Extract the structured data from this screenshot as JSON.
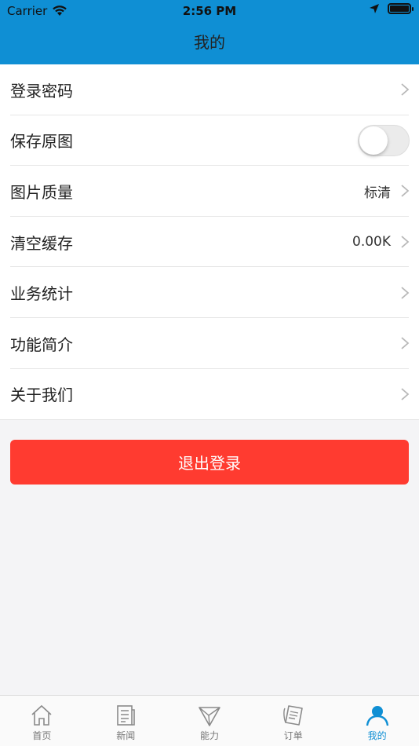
{
  "status_bar": {
    "carrier": "Carrier",
    "time": "2:56 PM"
  },
  "nav": {
    "title": "我的"
  },
  "settings": [
    {
      "label": "登录密码",
      "value": "",
      "kind": "chevron"
    },
    {
      "label": "保存原图",
      "value": "",
      "kind": "toggle",
      "enabled": false
    },
    {
      "label": "图片质量",
      "value": "标清",
      "kind": "chevron"
    },
    {
      "label": "清空缓存",
      "value": "0.00K",
      "kind": "chevron"
    },
    {
      "label": "业务统计",
      "value": "",
      "kind": "chevron"
    },
    {
      "label": "功能简介",
      "value": "",
      "kind": "chevron"
    },
    {
      "label": "关于我们",
      "value": "",
      "kind": "chevron"
    }
  ],
  "logout_label": "退出登录",
  "tabs": [
    {
      "label": "首页",
      "icon": "home-icon",
      "active": false
    },
    {
      "label": "新闻",
      "icon": "news-icon",
      "active": false
    },
    {
      "label": "能力",
      "icon": "paper-plane-icon",
      "active": false
    },
    {
      "label": "订单",
      "icon": "order-icon",
      "active": false
    },
    {
      "label": "我的",
      "icon": "user-icon",
      "active": true
    }
  ],
  "colors": {
    "accent": "#0f8fd4",
    "danger": "#ff3b30"
  }
}
